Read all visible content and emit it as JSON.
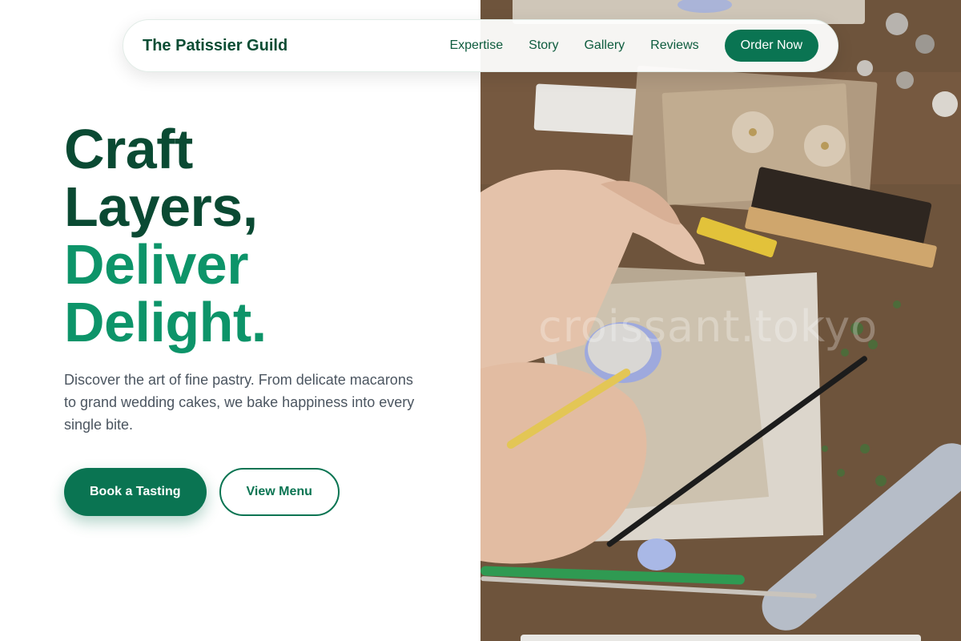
{
  "navbar": {
    "brand": "The Patissier Guild",
    "links": [
      "Expertise",
      "Story",
      "Gallery",
      "Reviews"
    ],
    "cta": "Order Now"
  },
  "hero": {
    "line1": "Craft",
    "line2": "Layers,",
    "line3": "Deliver",
    "line4": "Delight.",
    "lead": "Discover the art of fine pastry. From delicate macarons to grand wedding cakes, we bake happiness into every single bite.",
    "primary_cta": "Book a Tasting",
    "secondary_cta": "View Menu"
  },
  "photo": {
    "watermark": "croissant.tokyo"
  },
  "colors": {
    "brand_dark": "#0a4a33",
    "brand_green": "#0d9469",
    "button_green": "#0a7452",
    "body_text": "#4b5560"
  }
}
